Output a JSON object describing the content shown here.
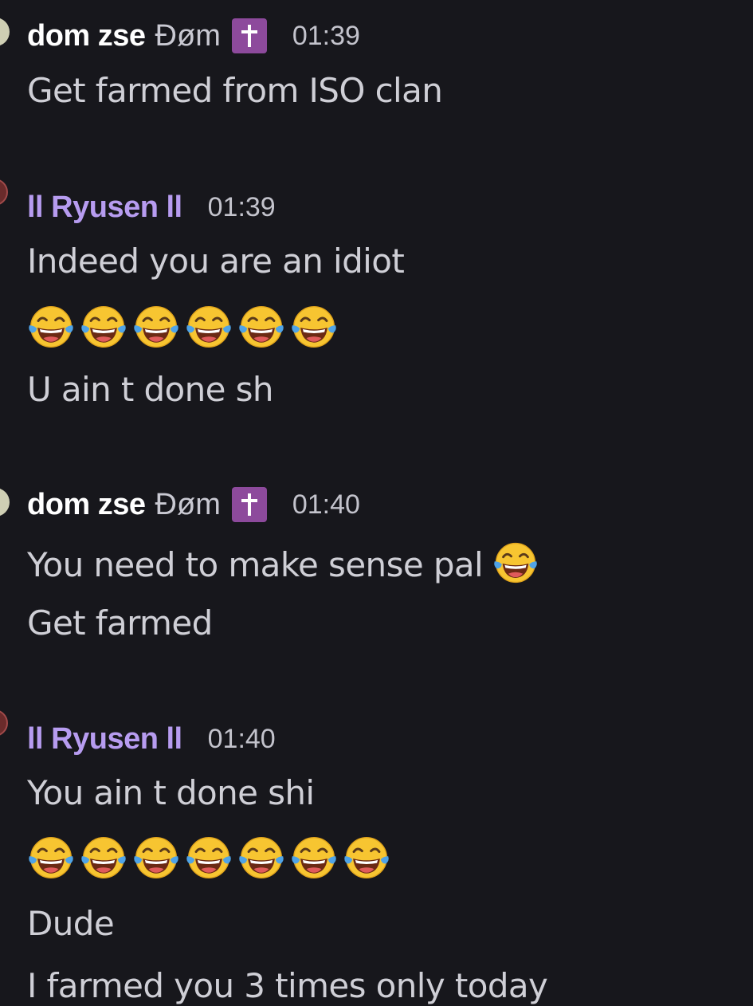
{
  "messages": [
    {
      "author": "dom zse",
      "tag": "Đøm",
      "tag_icon": "latin-cross-icon",
      "time": "01:39",
      "lines": [
        "Get farmed from ISO clan"
      ]
    },
    {
      "author": "ll Ryusen ll",
      "time": "01:39",
      "lines": [
        "Indeed you are an idiot",
        "U ain t done sh"
      ],
      "emoji_row": {
        "icon": "face-with-tears-of-joy-icon",
        "count": 6
      }
    },
    {
      "author": "dom zse",
      "tag": "Đøm",
      "tag_icon": "latin-cross-icon",
      "time": "01:40",
      "lines": [
        "You need to make sense pal",
        "Get farmed"
      ],
      "inline_emoji": "face-with-tears-of-joy-icon"
    },
    {
      "author": "ll Ryusen ll",
      "time": "01:40",
      "lines": [
        "You ain t done shi",
        "Dude",
        "I farmed you 3 times only today"
      ],
      "emoji_row": {
        "icon": "face-with-tears-of-joy-icon",
        "count": 7
      }
    }
  ],
  "colors": {
    "background": "#17171c",
    "username_dom": "#ffffff",
    "username_ryusen": "#b79cf0",
    "tag_badge": "#8d4a9c",
    "message_text": "#cfcfd6"
  }
}
